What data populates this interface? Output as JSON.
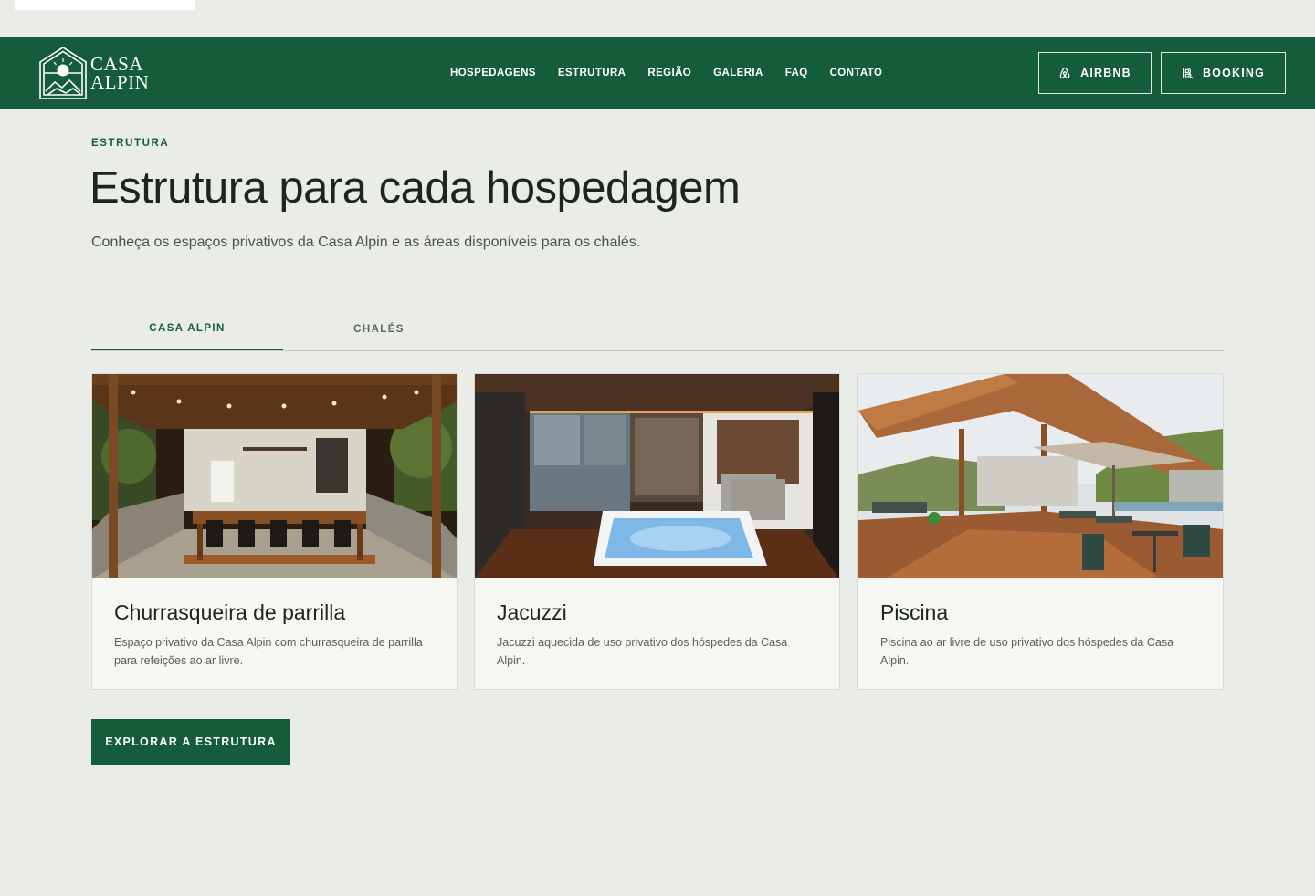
{
  "header": {
    "brand": {
      "line1": "CASA",
      "line2": "ALPIN"
    },
    "nav": [
      {
        "label": "HOSPEDAGENS"
      },
      {
        "label": "ESTRUTURA"
      },
      {
        "label": "REGIÃO"
      },
      {
        "label": "GALERIA"
      },
      {
        "label": "FAQ"
      },
      {
        "label": "CONTATO"
      }
    ],
    "buttons": {
      "airbnb": {
        "label": "AIRBNB",
        "icon": "airbnb-icon"
      },
      "booking": {
        "label": "BOOKING",
        "icon": "booking-icon"
      }
    }
  },
  "section": {
    "eyebrow": "ESTRUTURA",
    "title": "Estrutura para cada hospedagem",
    "subtitle": "Conheça os espaços privativos da Casa Alpin e as áreas disponíveis para os chalés."
  },
  "tabs": [
    {
      "label": "CASA ALPIN",
      "active": true
    },
    {
      "label": "CHALÉS",
      "active": false
    }
  ],
  "cards": [
    {
      "title": "Churrasqueira de parrilla",
      "description": "Espaço privativo da Casa Alpin com churrasqueira de parrilla para refeições ao ar livre."
    },
    {
      "title": "Jacuzzi",
      "description": "Jacuzzi aquecida de uso privativo dos hóspedes da Casa Alpin."
    },
    {
      "title": "Piscina",
      "description": "Piscina ao ar livre de uso privativo dos hóspedes da Casa Alpin."
    }
  ],
  "cta": {
    "label": "EXPLORAR A ESTRUTURA"
  },
  "colors": {
    "brand": "#145C3C",
    "background": "#EAECE7",
    "card": "#F6F6F3"
  }
}
